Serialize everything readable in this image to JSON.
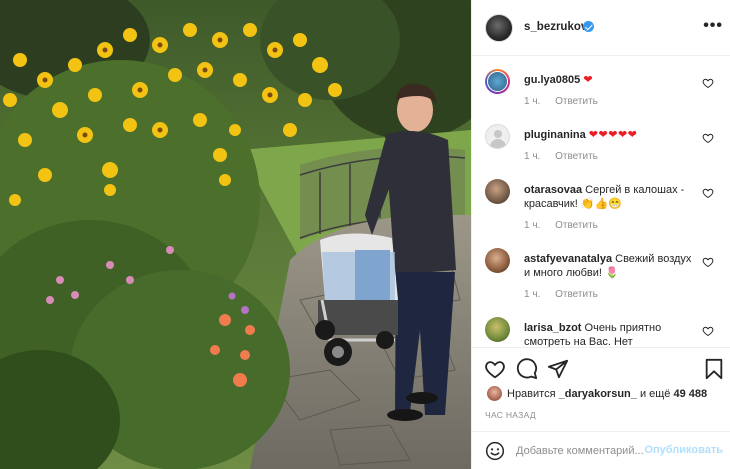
{
  "post": {
    "username": "s_bezrukov",
    "verified": true,
    "more_label": "•••"
  },
  "comments": [
    {
      "user": "gu.lya0805",
      "text": "",
      "hearts": "❤",
      "time": "1 ч.",
      "reply": "Ответить"
    },
    {
      "user": "pluginanina",
      "text": "",
      "hearts": "❤❤❤❤❤",
      "time": "1 ч.",
      "reply": "Ответить"
    },
    {
      "user": "otarasovaa",
      "text": "Сергей в калошах - красавчик! 👏👍😁",
      "hearts": "",
      "time": "1 ч.",
      "reply": "Ответить"
    },
    {
      "user": "astafyevanatalya",
      "text": "Свежий воздух и много любви! 🌷",
      "hearts": "",
      "time": "1 ч.",
      "reply": "Ответить"
    },
    {
      "user": "larisa_bzot",
      "text": "Очень приятно смотреть на Вас. Нет",
      "hearts": "",
      "time": "",
      "reply": ""
    }
  ],
  "likes": {
    "prefix": "Нравится",
    "user": "_daryakorsun_",
    "middle": "и ещё",
    "count": "49 488"
  },
  "time_ago": "ЧАС НАЗАД",
  "comment_box": {
    "placeholder": "Добавьте комментарий...",
    "publish_label": "Опубликовать"
  },
  "colors": {
    "link_blue": "#3897f0",
    "publish_disabled": "#b2dffc",
    "heart_red": "#ed1c24",
    "meta_gray": "#8e8e8e"
  },
  "icons": [
    "verified-badge",
    "more-icon",
    "heart-outline-icon",
    "comment-icon",
    "share-icon",
    "bookmark-icon",
    "emoji-icon"
  ]
}
